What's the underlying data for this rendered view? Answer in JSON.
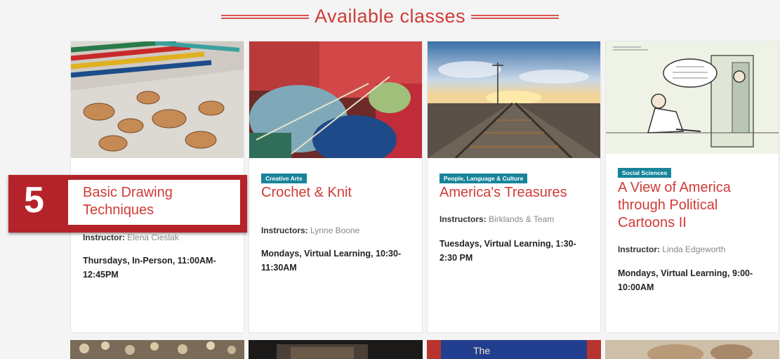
{
  "heading": "Available classes",
  "colors": {
    "accent": "#cf3b37",
    "tag": "#17849a",
    "callout": "#b5232a"
  },
  "callout": {
    "number": "5"
  },
  "cards": [
    {
      "image": "colored-pencils-shavings",
      "tag": "",
      "title": "Basic Drawing Techniques",
      "instr_label": "Instructor:",
      "instr_name": "Elena Cieslak",
      "schedule": "Thursdays, In-Person, 11:00AM-12:45PM"
    },
    {
      "image": "crochet-knitting",
      "tag": "Creative Arts",
      "title": "Crochet & Knit",
      "instr_label": "Instructors:",
      "instr_name": "Lynne Boone",
      "schedule": "Mondays, Virtual Learning, 10:30-11:30AM"
    },
    {
      "image": "railroad-tracks-sunset",
      "tag": "People, Language & Culture",
      "title": "America's Treasures",
      "instr_label": "Instructors:",
      "instr_name": "Birklands & Team",
      "schedule": "Tuesdays, Virtual Learning, 1:30-2:30 PM"
    },
    {
      "image": "political-cartoon",
      "tag": "Social Sciences",
      "title": "A View of America through Political Cartoons II",
      "instr_label": "Instructor:",
      "instr_name": "Linda Edgeworth",
      "schedule": "Mondays, Virtual Learning, 9:00-10:00AM"
    }
  ],
  "bottom_row": [
    {
      "image": "crowd-painting"
    },
    {
      "image": "dark-theater"
    },
    {
      "image": "blue-poster",
      "text": "The"
    },
    {
      "image": "classical-painting"
    }
  ]
}
